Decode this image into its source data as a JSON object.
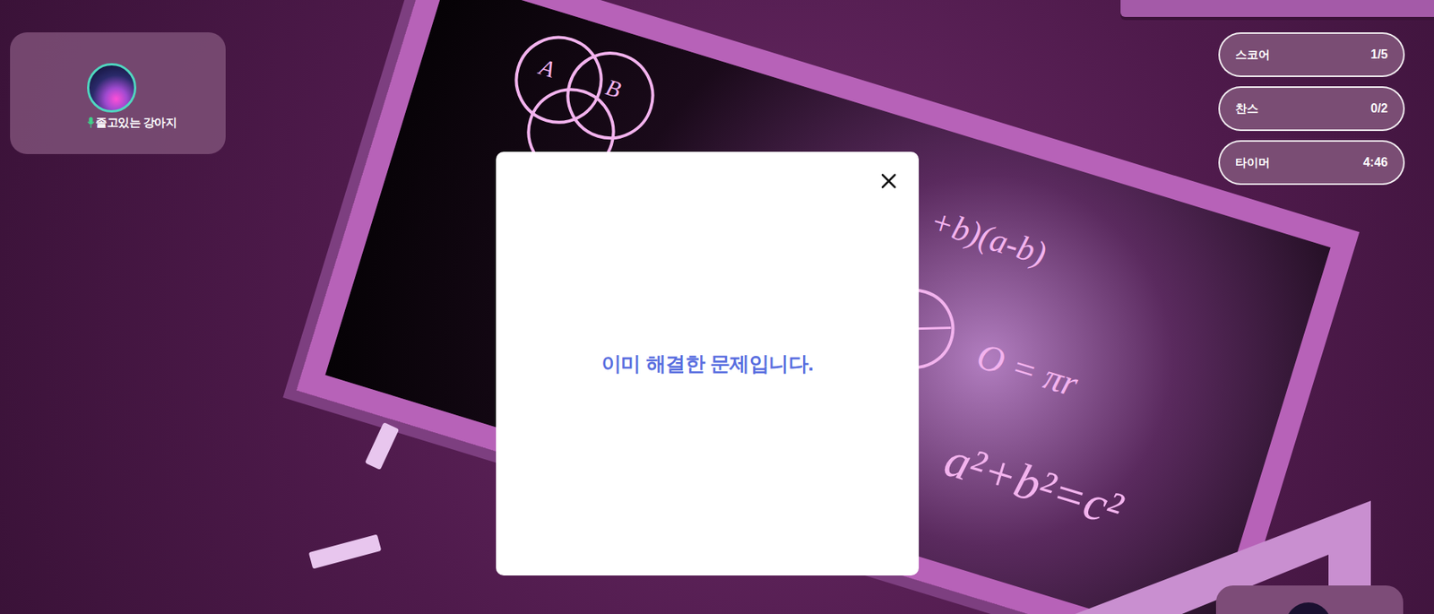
{
  "player": {
    "name": "졸고있는 강아지",
    "mic_on": true
  },
  "stats": [
    {
      "label": "스코어",
      "value": "1/5"
    },
    {
      "label": "찬스",
      "value": "0/2"
    },
    {
      "label": "타이머",
      "value": "4:46"
    }
  ],
  "board": {
    "labels": [
      "A",
      "B"
    ],
    "formulas": [
      "+b)(a-b)",
      "O = πr",
      "a²+b²=c²"
    ]
  },
  "modal": {
    "message": "이미 해결한 문제입니다."
  }
}
